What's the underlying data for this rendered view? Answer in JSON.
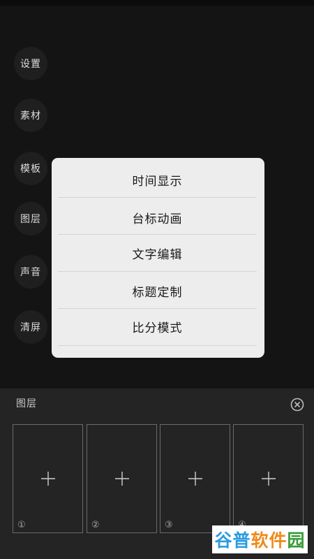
{
  "sidebar": {
    "items": [
      {
        "label": "设置"
      },
      {
        "label": "素材"
      },
      {
        "label": "模板"
      },
      {
        "label": "图层"
      },
      {
        "label": "声音"
      },
      {
        "label": "清屏"
      }
    ]
  },
  "popup_menu": {
    "items": [
      {
        "label": "时间显示"
      },
      {
        "label": "台标动画"
      },
      {
        "label": "文字编辑"
      },
      {
        "label": "标题定制"
      },
      {
        "label": "比分模式"
      }
    ]
  },
  "layer_panel": {
    "title": "图层",
    "close_icon": "close-circle-icon",
    "slots": [
      {
        "number": "①",
        "icon": "plus-icon"
      },
      {
        "number": "②",
        "icon": "plus-icon"
      },
      {
        "number": "③",
        "icon": "plus-icon"
      },
      {
        "number": "④",
        "icon": "plus-icon"
      }
    ]
  },
  "watermark": {
    "part1": "谷普",
    "part2": "软件",
    "part3": "园"
  },
  "colors": {
    "background": "#141414",
    "popup_background": "#ededed",
    "panel_background": "#242424",
    "watermark_blue": "#2a9be0",
    "watermark_orange": "#f08a1c",
    "watermark_green": "#3a9c3a"
  }
}
